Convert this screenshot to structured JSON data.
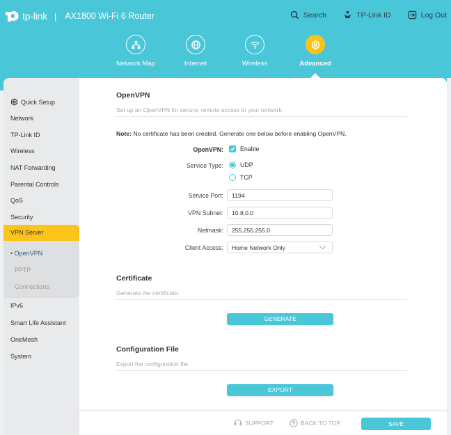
{
  "header": {
    "brand": "tp-link",
    "model": "AX1800 Wi-Fi 6 Router",
    "links": [
      {
        "label": "Search",
        "icon": "search-icon"
      },
      {
        "label": "TP-Link ID",
        "icon": "user-icon"
      },
      {
        "label": "Log Out",
        "icon": "logout-icon"
      }
    ],
    "colors": {
      "accent": "#4ac6d9",
      "active": "#fcc419"
    }
  },
  "nav": {
    "items": [
      {
        "label": "Network Map",
        "icon": "network-map-icon",
        "active": false
      },
      {
        "label": "Internet",
        "icon": "globe-icon",
        "active": false
      },
      {
        "label": "Wireless",
        "icon": "wifi-icon",
        "active": false
      },
      {
        "label": "Advanced",
        "icon": "gear-icon",
        "active": true
      }
    ]
  },
  "sidebar": {
    "items": [
      {
        "label": "Quick Setup",
        "icon": "gear-icon"
      },
      {
        "label": "Network"
      },
      {
        "label": "TP-Link ID"
      },
      {
        "label": "Wireless"
      },
      {
        "label": "NAT Forwarding"
      },
      {
        "label": "Parental Controls"
      },
      {
        "label": "QoS"
      },
      {
        "label": "Security"
      },
      {
        "label": "VPN Server",
        "active": true
      },
      {
        "label": "IPv6"
      },
      {
        "label": "Smart Life Assistant"
      },
      {
        "label": "OneMesh"
      },
      {
        "label": "System"
      }
    ],
    "sub_items": [
      {
        "label": "OpenVPN",
        "active": true
      },
      {
        "label": "PPTP"
      },
      {
        "label": "Connections"
      }
    ]
  },
  "openvpn": {
    "title": "OpenVPN",
    "description": "Set up an OpenVPN for secure, remote access to your network.",
    "note_label": "Note:",
    "note_text": " No certificate has been created. Generate one below before enabling OpenVPN.",
    "enable_label": "OpenVPN:",
    "enable_option": "Enable",
    "enable_checked": true,
    "service_type_label": "Service Type:",
    "service_types": [
      "UDP",
      "TCP"
    ],
    "service_type_selected": "UDP",
    "service_port_label": "Service Port:",
    "service_port": "1194",
    "vpn_subnet_label": "VPN Subnet:",
    "vpn_subnet": "10.8.0.0",
    "netmask_label": "Netmask:",
    "netmask": "255.255.255.0",
    "client_access_label": "Client Access:",
    "client_access": "Home Network Only"
  },
  "certificate": {
    "title": "Certificate",
    "description": "Generate the certificate.",
    "button": "GENERATE"
  },
  "config_file": {
    "title": "Configuration File",
    "description": "Export the configuration file.",
    "button": "EXPORT"
  },
  "footer": {
    "support": "SUPPORT",
    "back_to_top": "BACK TO TOP",
    "save": "SAVE"
  }
}
